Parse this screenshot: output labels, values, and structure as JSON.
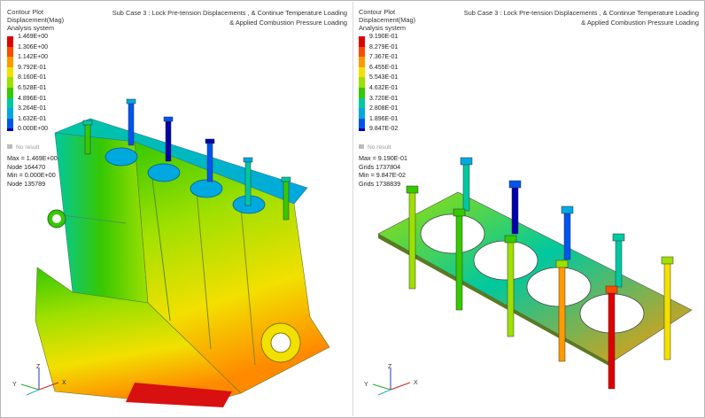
{
  "left_pane": {
    "title_lines": [
      "Contour Plot",
      "Displacement(Mag)",
      "Analysis system"
    ],
    "subcase_lines": [
      "Sub Case 3 : Lock Pre-tension Displacements , & Continue Temperature Loading",
      "& Applied Combustion Pressure Loading"
    ],
    "legend_values": [
      "1.469E+00",
      "1.306E+00",
      "1.142E+00",
      "9.792E-01",
      "8.160E-01",
      "6.528E-01",
      "4.896E-01",
      "3.264E-01",
      "1.632E-01",
      "0.000E+00"
    ],
    "no_result": "No result",
    "stats": [
      "Max = 1.469E+00",
      "Node 164470",
      "Min = 0.000E+00",
      "Node 135789"
    ]
  },
  "right_pane": {
    "title_lines": [
      "Contour Plot",
      "Displacement(Mag)",
      "Analysis system"
    ],
    "subcase_lines": [
      "Sub Case 3 : Lock Pre-tension Displacements , & Continue Temperature Loading",
      "& Applied Combustion Pressure Loading"
    ],
    "legend_values": [
      "9.190E-01",
      "8.279E-01",
      "7.367E-01",
      "6.455E-01",
      "5.543E-01",
      "4.632E-01",
      "3.720E-01",
      "2.808E-01",
      "1.896E-01",
      "9.847E-02"
    ],
    "no_result": "No result",
    "stats": [
      "Max = 9.190E-01",
      "Grids 1737804",
      "Min = 9.847E-02",
      "Grids 1738839"
    ]
  },
  "legend_colors": [
    "#e00000",
    "#ff4a00",
    "#ff9a00",
    "#f2e000",
    "#9ee000",
    "#36c800",
    "#00c8a0",
    "#00a8e0",
    "#0055ee",
    "#0000aa"
  ],
  "axis_labels": {
    "x": "X",
    "y": "Y",
    "z": "Z"
  }
}
